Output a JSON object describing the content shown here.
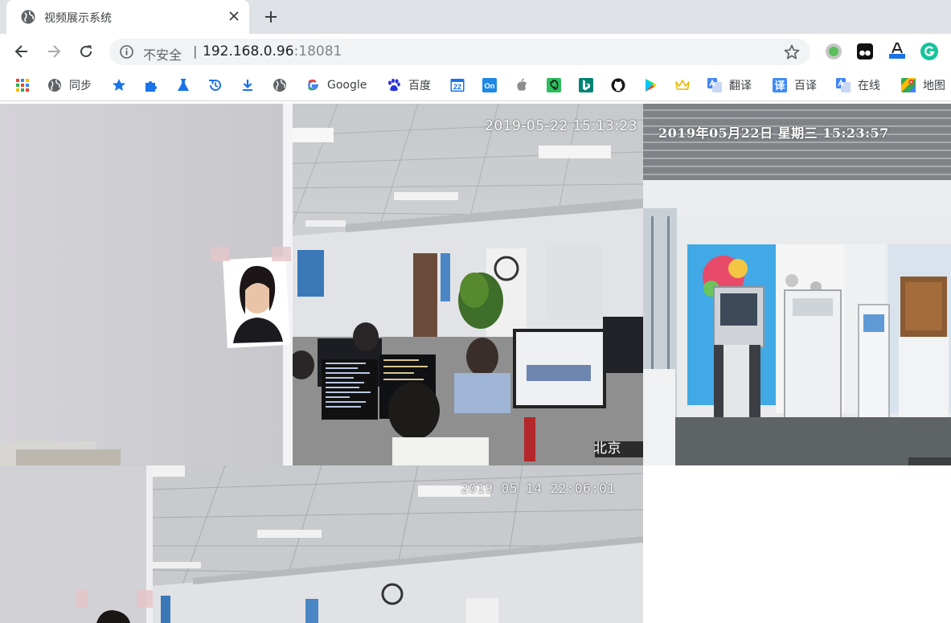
{
  "browser": {
    "tab": {
      "title": "视频展示系统",
      "favicon": "globe-icon"
    },
    "toolbar": {
      "security_label": "不安全",
      "separator": "|",
      "url_host": "192.168.0.96",
      "url_port": ":18081"
    },
    "bookmarks": [
      {
        "icon": "apps-grid-icon",
        "label": ""
      },
      {
        "icon": "globe-icon",
        "label": "同步"
      },
      {
        "icon": "star-icon",
        "label": ""
      },
      {
        "icon": "puzzle-icon",
        "label": ""
      },
      {
        "icon": "flask-icon",
        "label": ""
      },
      {
        "icon": "history-icon",
        "label": ""
      },
      {
        "icon": "download-icon",
        "label": ""
      },
      {
        "icon": "globe-icon",
        "label": ""
      },
      {
        "icon": "google-g-icon",
        "label": "Google"
      },
      {
        "icon": "paw-icon",
        "label": "百度"
      },
      {
        "icon": "calendar-icon",
        "label": ""
      },
      {
        "icon": "on-icon",
        "label": ""
      },
      {
        "icon": "apple-icon",
        "label": ""
      },
      {
        "icon": "evernote-icon",
        "label": ""
      },
      {
        "icon": "bing-icon",
        "label": ""
      },
      {
        "icon": "github-icon",
        "label": ""
      },
      {
        "icon": "play-store-icon",
        "label": ""
      },
      {
        "icon": "crown-icon",
        "label": ""
      },
      {
        "icon": "translate-icon",
        "label": "翻译"
      },
      {
        "icon": "yi-icon",
        "label": "百译"
      },
      {
        "icon": "translate-icon",
        "label": "在线"
      },
      {
        "icon": "maps-icon",
        "label": "地图"
      }
    ],
    "calendar_day": "22",
    "on_badge": "On",
    "yi_char": "译"
  },
  "videos": {
    "cam1": {
      "timestamp": "2019-05-22 15:13:23",
      "location": "北京"
    },
    "cam2": {
      "timestamp": "2019年05月22日  星期三  15:23:57"
    },
    "cam3": {
      "timestamp": "2019 05 14 22:06:01"
    }
  }
}
